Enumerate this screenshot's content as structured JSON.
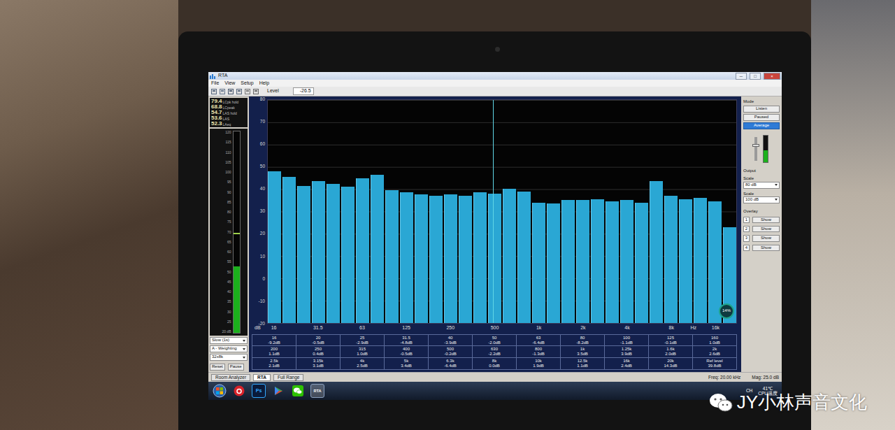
{
  "window": {
    "title": "RTA",
    "controls": [
      "─",
      "□",
      "×"
    ]
  },
  "menu": [
    "File",
    "View",
    "Setup",
    "Help"
  ],
  "toolbar": {
    "level_label": "Level",
    "level_value": "-26.5"
  },
  "meter": {
    "readings": [
      {
        "value": "79.4",
        "label": "LCpk hold"
      },
      {
        "value": "68.8",
        "label": "LCpeak"
      },
      {
        "value": "54.7",
        "label": "LAS hold"
      },
      {
        "value": "53.6",
        "label": "LAS"
      },
      {
        "value": "52.3",
        "label": "LAeq"
      }
    ],
    "scale": [
      "120",
      "115",
      "110",
      "105",
      "100",
      "95",
      "90",
      "85",
      "80",
      "75",
      "70",
      "65",
      "60",
      "55",
      "50",
      "45",
      "40",
      "35",
      "30",
      "25",
      "20 dB"
    ],
    "level": 0.33,
    "peak": 0.49,
    "selects": [
      "Slow (1s)",
      "A - Weighting",
      "32x8k"
    ],
    "buttons": [
      "Reset",
      "Pause"
    ]
  },
  "chart": {
    "y_unit": "dB",
    "y_ticks": [
      "80",
      "70",
      "60",
      "50",
      "40",
      "30",
      "20",
      "10",
      "0",
      "-10",
      "-20"
    ],
    "y_min": -20,
    "y_max": 80,
    "x_unit": "Hz",
    "x_ticks": [
      "16",
      "31.5",
      "63",
      "125",
      "250",
      "500",
      "1k",
      "2k",
      "4k",
      "8k",
      "16k"
    ],
    "series": [
      {
        "name": "RTA",
        "values": [
          48,
          45.5,
          41.5,
          43.5,
          42.5,
          41,
          45,
          46.5,
          39.5,
          38.5,
          37.5,
          37,
          37.5,
          37,
          38.5,
          38,
          40,
          39,
          34,
          33.5,
          35,
          35,
          35.5,
          34.5,
          35,
          34,
          43.5,
          37,
          35.5,
          36,
          34.5,
          23
        ]
      }
    ],
    "cursor": {
      "level": 0.48
    },
    "widget": {
      "percent": "14%"
    }
  },
  "table": {
    "rows": [
      [
        {
          "freq": "16",
          "value": "-9.2dB"
        },
        {
          "freq": "20",
          "value": "-0.5dB"
        },
        {
          "freq": "25",
          "value": "-2.9dB"
        },
        {
          "freq": "31.5",
          "value": "-4.8dB"
        },
        {
          "freq": "40",
          "value": "-3.9dB"
        },
        {
          "freq": "50",
          "value": "-2.0dB"
        },
        {
          "freq": "63",
          "value": "-6.4dB"
        },
        {
          "freq": "80",
          "value": "-8.2dB"
        },
        {
          "freq": "100",
          "value": "-1.1dB"
        },
        {
          "freq": "125",
          "value": "-0.1dB"
        },
        {
          "freq": "160",
          "value": "1.0dB"
        }
      ],
      [
        {
          "freq": "200",
          "value": "1.1dB"
        },
        {
          "freq": "250",
          "value": "0.4dB"
        },
        {
          "freq": "315",
          "value": "1.0dB"
        },
        {
          "freq": "400",
          "value": "-0.5dB"
        },
        {
          "freq": "500",
          "value": "-0.2dB"
        },
        {
          "freq": "630",
          "value": "-2.2dB"
        },
        {
          "freq": "800",
          "value": "-1.3dB"
        },
        {
          "freq": "1k",
          "value": "3.5dB"
        },
        {
          "freq": "1.25k",
          "value": "3.9dB"
        },
        {
          "freq": "1.6k",
          "value": "2.0dB"
        },
        {
          "freq": "2k",
          "value": "2.6dB"
        }
      ],
      [
        {
          "freq": "2.5k",
          "value": "2.1dB"
        },
        {
          "freq": "3.15k",
          "value": "3.1dB"
        },
        {
          "freq": "4k",
          "value": "2.5dB"
        },
        {
          "freq": "5k",
          "value": "3.4dB"
        },
        {
          "freq": "6.3k",
          "value": "-6.4dB"
        },
        {
          "freq": "8k",
          "value": "0.0dB"
        },
        {
          "freq": "10k",
          "value": "1.9dB"
        },
        {
          "freq": "12.5k",
          "value": "1.1dB"
        },
        {
          "freq": "16k",
          "value": "2.4dB"
        },
        {
          "freq": "20k",
          "value": "14.3dB"
        },
        {
          "freq": "Ref level",
          "value": "39.8dB"
        }
      ]
    ]
  },
  "right_panel": {
    "mode_label": "Mode",
    "modes": [
      {
        "label": "Listen",
        "selected": false
      },
      {
        "label": "Paused",
        "selected": false
      },
      {
        "label": "Average",
        "selected": true
      }
    ],
    "output_level": 0.45,
    "output_label": "Output",
    "scales": [
      {
        "label": "Scale",
        "value": "80 dB"
      },
      {
        "label": "Scale",
        "value": "100 dB"
      }
    ],
    "overlay_label": "Overlay",
    "overlays": [
      {
        "num": "1",
        "label": "Show",
        "checked": false
      },
      {
        "num": "2",
        "label": "Show",
        "checked": false
      },
      {
        "num": "3",
        "label": "Show",
        "checked": false
      },
      {
        "num": "4",
        "label": "Show",
        "checked": false
      }
    ]
  },
  "tabs": [
    {
      "label": "Room Analyzer",
      "selected": false
    },
    {
      "label": "RTA",
      "selected": true
    },
    {
      "label": "Full Range",
      "selected": false
    }
  ],
  "status": [
    "Freq: 20.00 kHz",
    "Mag: 25.0 dB"
  ],
  "taskbar": {
    "apps": [
      {
        "kind": "netease",
        "text": ""
      },
      {
        "kind": "ps",
        "text": "Ps"
      },
      {
        "kind": "play",
        "text": ""
      },
      {
        "kind": "wechat",
        "text": ""
      },
      {
        "kind": "rta",
        "text": "RTA"
      }
    ],
    "tray": {
      "lang": "CH",
      "temp": "41℃",
      "temp_label": "CPU温度"
    }
  },
  "watermark": "JY小林声音文化"
}
